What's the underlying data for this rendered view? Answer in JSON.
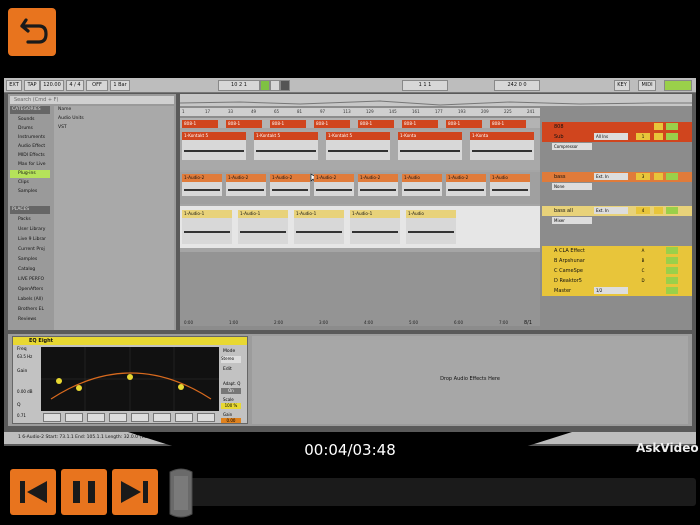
{
  "player": {
    "elapsed": "00:04",
    "duration": "03:48",
    "time_label": "00:04/03:48",
    "progress": 0.0175,
    "watermark": "AskVideo",
    "accent": "#e8741e"
  },
  "transport": {
    "ext": "EXT",
    "tap": "TAP",
    "tempo": "120.00",
    "sig": "4 / 4",
    "quant": "1 Bar",
    "metro": "OFF",
    "pos": "10  2  1",
    "loop_start": "1  1  1",
    "loop_len": "242  0  0",
    "key": "KEY",
    "midi": "MIDI"
  },
  "browser": {
    "search_placeholder": "Search (Cmd + F)",
    "categories_header": "CATEGORIES",
    "categories": [
      "Sounds",
      "Drums",
      "Instruments",
      "Audio Effect",
      "MIDI Effects",
      "Max for Live",
      "Plug-ins",
      "Clips",
      "Samples"
    ],
    "selected_category": "Plug-ins",
    "places_header": "PLACES",
    "places": [
      "Packs",
      "User Library",
      "Live 9 Librar",
      "Current Proj",
      "Samples",
      "Catalog",
      "LIVE PERFO",
      "OpenAfters",
      "Labels (All)",
      "Brothers EL",
      "Reviews"
    ],
    "name_header": "Name",
    "files": [
      "Audio Units",
      "VST"
    ]
  },
  "ruler": {
    "bars": [
      "1",
      "17",
      "33",
      "49",
      "65",
      "81",
      "97",
      "113",
      "129",
      "145",
      "161",
      "177",
      "193",
      "209",
      "225",
      "241"
    ],
    "times": [
      "0:00",
      "1:00",
      "2:00",
      "3:00",
      "4:00",
      "5:00",
      "6:00",
      "7:00"
    ],
    "page": "8/1"
  },
  "tracks": [
    {
      "name": "808",
      "color": "#d0451e",
      "device": "",
      "io": "",
      "vol": ""
    },
    {
      "name": "Sub",
      "color": "#d0451e",
      "device": "Compressor",
      "io": "All Ins",
      "vol": "1"
    },
    {
      "name": "bass",
      "color": "#e07b3a",
      "device": "None",
      "io": "Ext. In",
      "vol": "3"
    },
    {
      "name": "bass all",
      "color": "#e8d27a",
      "device": "Mixer",
      "io": "Ext. In",
      "vol": "4"
    },
    {
      "name": "A CLA Effect",
      "color": "#e8c53a",
      "device": "",
      "io": "",
      "vol": "A"
    },
    {
      "name": "B Arpshunar",
      "color": "#e8c53a",
      "device": "",
      "io": "",
      "vol": "B"
    },
    {
      "name": "C CameSpe",
      "color": "#e8c53a",
      "device": "",
      "io": "",
      "vol": "C"
    },
    {
      "name": "D Reaktor5",
      "color": "#e8c53a",
      "device": "",
      "io": "",
      "vol": "D"
    },
    {
      "name": "Master",
      "color": "#e8c53a",
      "device": "",
      "io": "1/2",
      "vol": ""
    }
  ],
  "clips": {
    "row1": [
      "808-1",
      "808-1",
      "808-1",
      "808-1",
      "808-1",
      "808-1",
      "808-1",
      "808-1"
    ],
    "row2": [
      "1-Kontakt 5",
      "1-Kontakt 5",
      "1-Kontakt 5",
      "1-Konta",
      "1-Konta"
    ],
    "row3": [
      "1-Audio-2",
      "1-Audio-2",
      "1-Audio-2",
      "1-Audio-2",
      "1-Audio-2",
      "1-Audio",
      "1-Audio-2",
      "1-Audio"
    ],
    "row4": [
      "1-Audio-1",
      "1-Audio-1",
      "1-Audio-1",
      "1-Audio-1",
      "1-Audio"
    ],
    "deactive": "Deactive"
  },
  "eq": {
    "title": "EQ Eight",
    "freq": "Freq",
    "freq_val": "63.5 Hz",
    "gain": "Gain",
    "gain_val": "0.00 dB",
    "q": "Q",
    "q_val": "0.71",
    "mode_label": "Mode",
    "mode": "Stereo",
    "edit_label": "Edit",
    "adapt_label": "Adapt. Q",
    "adapt": "On",
    "scale_label": "Scale",
    "scale": "100 %",
    "gain_out_label": "Gain",
    "gain_out": "0.00"
  },
  "drop_text": "Drop Audio Effects Here",
  "status": "1 6-Audio-2  Start: 73.1.1  End: 105.1.1  Length: 32.0.0  (Veran/Arbeits)"
}
